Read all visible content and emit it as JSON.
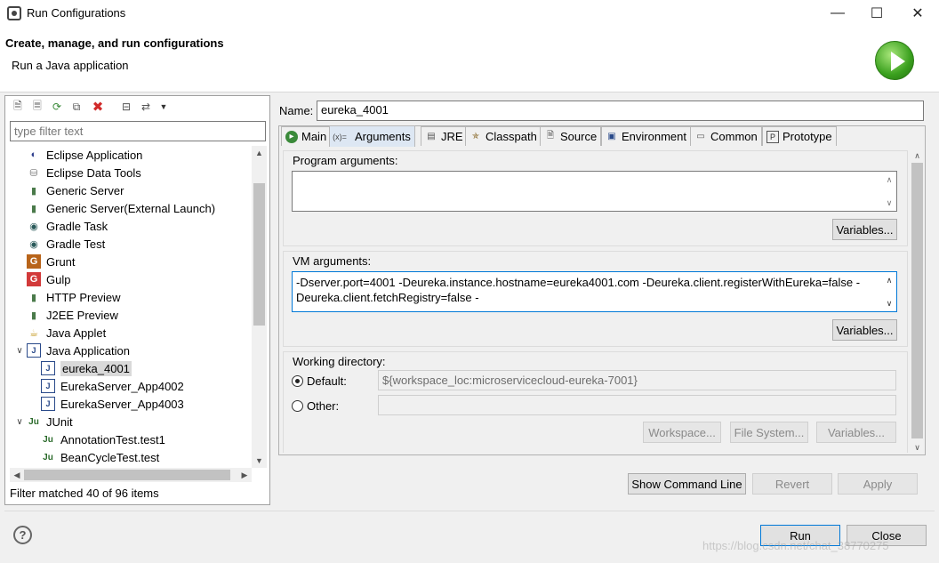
{
  "window": {
    "title": "Run Configurations"
  },
  "header": {
    "title": "Create, manage, and run configurations",
    "subtitle": "Run a Java application"
  },
  "left": {
    "filter_placeholder": "type filter text",
    "tree": [
      {
        "label": "Eclipse Application",
        "icon": "eclipse-icon",
        "level": 1
      },
      {
        "label": "Eclipse Data Tools",
        "icon": "database-icon",
        "level": 1
      },
      {
        "label": "Generic Server",
        "icon": "server-icon",
        "level": 1
      },
      {
        "label": "Generic Server(External Launch)",
        "icon": "server-icon",
        "level": 1
      },
      {
        "label": "Gradle Task",
        "icon": "gradle-icon",
        "level": 1
      },
      {
        "label": "Gradle Test",
        "icon": "gradle-icon",
        "level": 1
      },
      {
        "label": "Grunt",
        "icon": "grunt-icon",
        "level": 1
      },
      {
        "label": "Gulp",
        "icon": "gulp-icon",
        "level": 1
      },
      {
        "label": "HTTP Preview",
        "icon": "server-icon",
        "level": 1
      },
      {
        "label": "J2EE Preview",
        "icon": "server-icon",
        "level": 1
      },
      {
        "label": "Java Applet",
        "icon": "applet-icon",
        "level": 1
      },
      {
        "label": "Java Application",
        "icon": "java-app-icon",
        "level": 1,
        "expanded": true
      },
      {
        "label": "eureka_4001",
        "icon": "java-app-icon",
        "level": 2,
        "selected": true
      },
      {
        "label": "EurekaServer_App4002",
        "icon": "java-app-icon",
        "level": 2
      },
      {
        "label": "EurekaServer_App4003",
        "icon": "java-app-icon",
        "level": 2
      },
      {
        "label": "JUnit",
        "icon": "junit-icon",
        "level": 1,
        "expanded": true
      },
      {
        "label": "AnnotationTest.test1",
        "icon": "junit-icon",
        "level": 2
      },
      {
        "label": "BeanCycleTest.test",
        "icon": "junit-icon",
        "level": 2
      }
    ],
    "filter_status": "Filter matched 40 of 96 items"
  },
  "config": {
    "name_label": "Name:",
    "name_value": "eureka_4001",
    "tabs": [
      {
        "label": "Main",
        "icon": "main-icon"
      },
      {
        "label": "Arguments",
        "icon": "arguments-icon",
        "active": true
      },
      {
        "label": "JRE",
        "icon": "jre-icon"
      },
      {
        "label": "Classpath",
        "icon": "classpath-icon"
      },
      {
        "label": "Source",
        "icon": "source-icon"
      },
      {
        "label": "Environment",
        "icon": "environment-icon"
      },
      {
        "label": "Common",
        "icon": "common-icon"
      },
      {
        "label": "Prototype",
        "icon": "prototype-icon"
      }
    ],
    "program_args_label": "Program arguments:",
    "program_args_value": "",
    "variables_label": "Variables...",
    "vm_args_label": "VM arguments:",
    "vm_args_lines": [
      "-Dserver.port=4001 -Deureka.instance.hostname=eureka4001.com -Deureka.client.registerWithEureka=false -",
      "Deureka.client.fetchRegistry=false -"
    ],
    "working_dir_label": "Working directory:",
    "default_label": "Default:",
    "default_value": "${workspace_loc:microservicecloud-eureka-7001}",
    "other_label": "Other:",
    "other_value": "",
    "workspace_btn": "Workspace...",
    "filesystem_btn": "File System...",
    "variables_btn": "Variables..."
  },
  "buttons": {
    "show_command_line": "Show Command Line",
    "revert": "Revert",
    "apply": "Apply",
    "run": "Run",
    "close": "Close"
  },
  "watermark": "https://blog.csdn.net/chat_38770275"
}
